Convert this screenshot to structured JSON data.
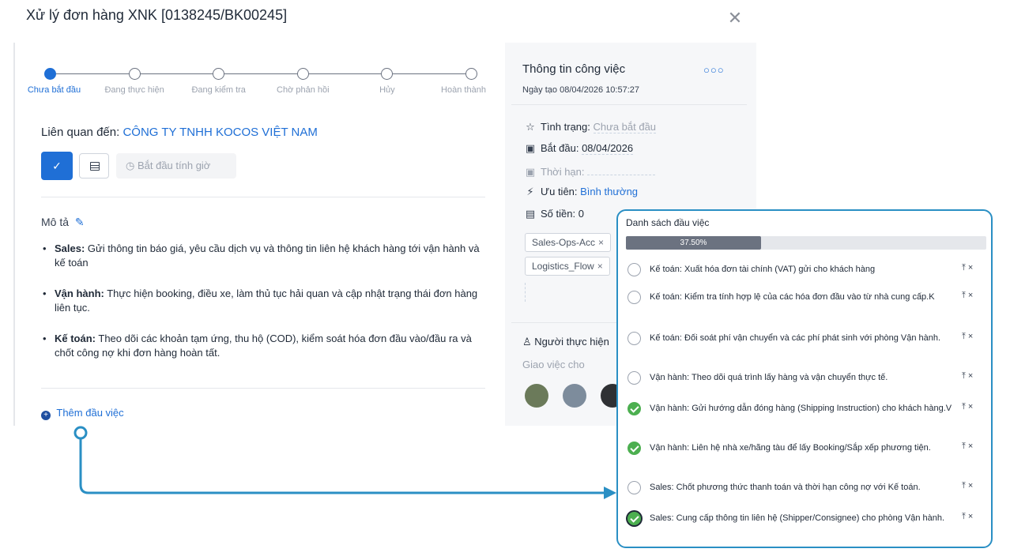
{
  "modal": {
    "title": "Xử lý đơn hàng XNK [0138245/BK00245]",
    "close_icon": "✕"
  },
  "stepper": {
    "steps": [
      {
        "label": "Chưa bắt đầu",
        "active": true
      },
      {
        "label": "Đang thực hiện",
        "active": false
      },
      {
        "label": "Đang kiểm tra",
        "active": false
      },
      {
        "label": "Chờ phản hồi",
        "active": false
      },
      {
        "label": "Hủy",
        "active": false
      },
      {
        "label": "Hoàn thành",
        "active": false
      }
    ]
  },
  "related": {
    "prefix": "Liên quan đến:",
    "company": "CÔNG TY TNHH KOCOS VIỆT NAM"
  },
  "toolbar": {
    "check_icon": "✓",
    "timer_icon": "◷",
    "timer_label": "Bắt đầu tính giờ"
  },
  "description": {
    "title": "Mô tả",
    "edit_icon": "✎",
    "items": [
      {
        "role": "Sales:",
        "text": " Gửi thông tin báo giá, yêu cầu dịch vụ và thông tin liên hệ khách hàng tới vận hành và kế toán"
      },
      {
        "role": "Vận hành:",
        "text": " Thực hiện booking, điều xe, làm thủ tục hải quan và cập nhật trạng thái đơn hàng liên tục."
      },
      {
        "role": "Kế toán:",
        "text": " Theo dõi các khoản tạm ứng, thu hộ (COD), kiểm soát hóa đơn đầu vào/đầu ra và chốt công nợ khi đơn hàng hoàn tất."
      }
    ]
  },
  "add_task": {
    "label": "Thêm đầu việc",
    "icon": "+"
  },
  "info_panel": {
    "title": "Thông tin công việc",
    "more_icon": "○○○",
    "created_date": "Ngày tạo 08/04/2026 10:57:27",
    "status": {
      "icon": "☆",
      "label": "Tình trạng:",
      "value": "Chưa bắt đầu"
    },
    "start": {
      "icon": "▣",
      "label": "Bắt đầu:",
      "value": "08/04/2026"
    },
    "deadline": {
      "icon": "▣",
      "label": "Thời hạn:"
    },
    "priority": {
      "icon": "⚡",
      "label": "Ưu tiên:",
      "value": "Bình thường"
    },
    "amount": {
      "icon": "▤",
      "label": "Số tiền:",
      "value": "0"
    },
    "tags": [
      {
        "label": "Sales-Ops-Acc",
        "remove": "×"
      },
      {
        "label": "Logistics_Flow",
        "remove": "×"
      }
    ],
    "assignee": {
      "icon": "♙",
      "label": "Người thực hiện",
      "sub": "Giao việc cho"
    },
    "avatar_colors": [
      "#6b7a5a",
      "#7d8c9c",
      "#2f3134"
    ]
  },
  "checklist": {
    "title": "Danh sách đầu việc",
    "progress": {
      "value": 0.375,
      "label": "37.50%"
    },
    "move_icon": "⤒",
    "remove_icon": "×",
    "items": [
      {
        "text": "Kế toán: Xuất hóa đơn tài chính (VAT) gửi cho khách hàng",
        "done": false,
        "focus": false
      },
      {
        "text": "Kế toán: Kiểm tra tính hợp lệ của các hóa đơn đầu vào từ nhà cung cấp.K",
        "done": false,
        "focus": false
      },
      {
        "text": "Kế toán: Đối soát phí vận chuyển và các phí phát sinh với phòng Vận hành.",
        "done": false,
        "focus": false
      },
      {
        "text": "Vận hành: Theo dõi quá trình lấy hàng và vận chuyển thực tế.",
        "done": false,
        "focus": false
      },
      {
        "text": "Vận hành: Gửi hướng dẫn đóng hàng (Shipping Instruction) cho khách hàng.V",
        "done": true,
        "focus": false
      },
      {
        "text": "Vận hành: Liên hệ nhà xe/hãng tàu để lấy Booking/Sắp xếp phương tiện.",
        "done": true,
        "focus": false
      },
      {
        "text": "Sales: Chốt phương thức thanh toán và thời hạn công nợ với Kế toán.",
        "done": false,
        "focus": false
      },
      {
        "text": "Sales: Cung cấp thông tin liên hệ (Shipper/Consignee) cho phòng Vận hành.",
        "done": true,
        "focus": true
      }
    ]
  },
  "accent_color": "#1f6fd6",
  "callout_color": "#2a8fc4"
}
